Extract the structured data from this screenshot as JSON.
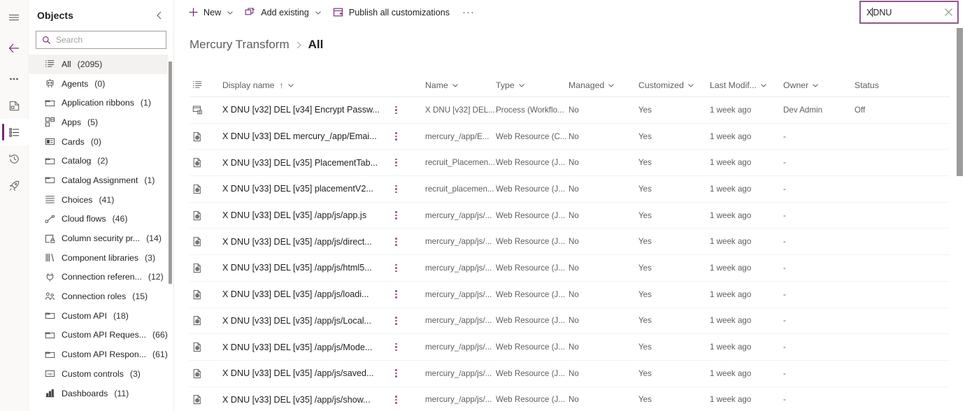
{
  "rail": {
    "items": [
      {
        "name": "hamburger-menu-icon",
        "label": "Menu"
      },
      {
        "name": "back-arrow-icon",
        "label": "Back"
      },
      {
        "name": "more-options-icon",
        "label": "More"
      },
      {
        "name": "solution-icon",
        "label": "Solution"
      },
      {
        "name": "objects-icon",
        "label": "Objects"
      },
      {
        "name": "history-icon",
        "label": "History"
      },
      {
        "name": "rocket-icon",
        "label": "Publish"
      }
    ]
  },
  "sidebar": {
    "title": "Objects",
    "collapse_label": "Collapse",
    "search": {
      "placeholder": "Search",
      "value": ""
    },
    "items": [
      {
        "label": "All",
        "count": "(2095)",
        "icon": "list-icon",
        "selected": true
      },
      {
        "label": "Agents",
        "count": "(0)",
        "icon": "agent-icon",
        "selected": false
      },
      {
        "label": "Application ribbons",
        "count": "(1)",
        "icon": "folder-icon",
        "selected": false
      },
      {
        "label": "Apps",
        "count": "(5)",
        "icon": "apps-icon",
        "selected": false
      },
      {
        "label": "Cards",
        "count": "(0)",
        "icon": "card-icon",
        "selected": false
      },
      {
        "label": "Catalog",
        "count": "(2)",
        "icon": "folder-icon",
        "selected": false
      },
      {
        "label": "Catalog Assignment",
        "count": "(1)",
        "icon": "folder-icon",
        "selected": false
      },
      {
        "label": "Choices",
        "count": "(41)",
        "icon": "choices-icon",
        "selected": false
      },
      {
        "label": "Cloud flows",
        "count": "(46)",
        "icon": "cloudflow-icon",
        "selected": false
      },
      {
        "label": "Column security pr...",
        "count": "(14)",
        "icon": "column-security-icon",
        "selected": false
      },
      {
        "label": "Component libraries",
        "count": "(3)",
        "icon": "library-icon",
        "selected": false
      },
      {
        "label": "Connection referen...",
        "count": "(12)",
        "icon": "connection-icon",
        "selected": false
      },
      {
        "label": "Connection roles",
        "count": "(15)",
        "icon": "roles-icon",
        "selected": false
      },
      {
        "label": "Custom API",
        "count": "(18)",
        "icon": "folder-icon",
        "selected": false
      },
      {
        "label": "Custom API Reques...",
        "count": "(66)",
        "icon": "folder-icon",
        "selected": false
      },
      {
        "label": "Custom API Respon...",
        "count": "(61)",
        "icon": "folder-icon",
        "selected": false
      },
      {
        "label": "Custom controls",
        "count": "(3)",
        "icon": "custom-control-icon",
        "selected": false
      },
      {
        "label": "Dashboards",
        "count": "(11)",
        "icon": "dashboard-icon",
        "selected": false
      }
    ]
  },
  "commandbar": {
    "new_label": "New",
    "add_existing_label": "Add existing",
    "publish_label": "Publish all customizations",
    "overflow_label": "···"
  },
  "topsearch": {
    "value": "X DNU",
    "value_before_caret": "X",
    "value_after_caret": "DNU",
    "clear_label": "Clear"
  },
  "breadcrumb": {
    "parent": "Mercury Transform",
    "separator": "›",
    "current": "All"
  },
  "table": {
    "columns": [
      {
        "key": "icon",
        "label": ""
      },
      {
        "key": "display_name",
        "label": "Display name",
        "sorted": "↑",
        "has_chevron": true
      },
      {
        "key": "kebab",
        "label": ""
      },
      {
        "key": "name",
        "label": "Name",
        "has_chevron": true
      },
      {
        "key": "type",
        "label": "Type",
        "has_chevron": true
      },
      {
        "key": "managed",
        "label": "Managed",
        "has_chevron": true
      },
      {
        "key": "customized",
        "label": "Customized",
        "has_chevron": true
      },
      {
        "key": "last_modified",
        "label": "Last Modif...",
        "has_chevron": true
      },
      {
        "key": "owner",
        "label": "Owner",
        "has_chevron": true
      },
      {
        "key": "status",
        "label": "Status",
        "has_chevron": false
      }
    ],
    "rows": [
      {
        "icon": "process-icon",
        "display_name": "X DNU [v32] DEL [v34] Encrypt Passw...",
        "name": "X DNU [v32] DEL...",
        "type": "Process (Workflo...",
        "managed": "No",
        "customized": "Yes",
        "last_modified": "1 week ago",
        "owner": "Dev Admin",
        "status": "Off"
      },
      {
        "icon": "webresource-icon",
        "display_name": "X DNU [v33] DEL mercury_/app/Emai...",
        "name": "mercury_/app/E...",
        "type": "Web Resource (C...",
        "managed": "No",
        "customized": "Yes",
        "last_modified": "1 week ago",
        "owner": "-",
        "status": ""
      },
      {
        "icon": "webresource-icon",
        "display_name": "X DNU [v33] DEL [v35] PlacementTab...",
        "name": "recruit_Placemen...",
        "type": "Web Resource (J...",
        "managed": "No",
        "customized": "Yes",
        "last_modified": "1 week ago",
        "owner": "-",
        "status": ""
      },
      {
        "icon": "webresource-icon",
        "display_name": "X DNU [v33] DEL [v35] placementV2...",
        "name": "recruit_placemen...",
        "type": "Web Resource (J...",
        "managed": "No",
        "customized": "Yes",
        "last_modified": "1 week ago",
        "owner": "-",
        "status": ""
      },
      {
        "icon": "webresource-icon",
        "display_name": "X DNU [v33] DEL [v35] /app/js/app.js",
        "name": "mercury_/app/js/...",
        "type": "Web Resource (J...",
        "managed": "No",
        "customized": "Yes",
        "last_modified": "1 week ago",
        "owner": "-",
        "status": ""
      },
      {
        "icon": "webresource-icon",
        "display_name": "X DNU [v33] DEL [v35] /app/js/direct...",
        "name": "mercury_/app/js/...",
        "type": "Web Resource (J...",
        "managed": "No",
        "customized": "Yes",
        "last_modified": "1 week ago",
        "owner": "-",
        "status": ""
      },
      {
        "icon": "webresource-icon",
        "display_name": "X DNU [v33] DEL [v35] /app/js/html5...",
        "name": "mercury_/app/js/...",
        "type": "Web Resource (J...",
        "managed": "No",
        "customized": "Yes",
        "last_modified": "1 week ago",
        "owner": "-",
        "status": ""
      },
      {
        "icon": "webresource-icon",
        "display_name": "X DNU [v33] DEL [v35] /app/js/loadi...",
        "name": "mercury_/app/js/...",
        "type": "Web Resource (J...",
        "managed": "No",
        "customized": "Yes",
        "last_modified": "1 week ago",
        "owner": "-",
        "status": ""
      },
      {
        "icon": "webresource-icon",
        "display_name": "X DNU [v33] DEL [v35] /app/js/Local...",
        "name": "mercury_/app/js/...",
        "type": "Web Resource (J...",
        "managed": "No",
        "customized": "Yes",
        "last_modified": "1 week ago",
        "owner": "-",
        "status": ""
      },
      {
        "icon": "webresource-icon",
        "display_name": "X DNU [v33] DEL [v35] /app/js/Mode...",
        "name": "mercury_/app/js/...",
        "type": "Web Resource (J...",
        "managed": "No",
        "customized": "Yes",
        "last_modified": "1 week ago",
        "owner": "-",
        "status": ""
      },
      {
        "icon": "webresource-icon",
        "display_name": "X DNU [v33] DEL [v35] /app/js/saved...",
        "name": "mercury_/app/js/...",
        "type": "Web Resource (J...",
        "managed": "No",
        "customized": "Yes",
        "last_modified": "1 week ago",
        "owner": "-",
        "status": ""
      },
      {
        "icon": "webresource-icon",
        "display_name": "X DNU [v33] DEL [v35] /app/js/show...",
        "name": "mercury_/app/js/...",
        "type": "Web Resource (J...",
        "managed": "No",
        "customized": "Yes",
        "last_modified": "1 week ago",
        "owner": "-",
        "status": ""
      }
    ]
  },
  "colors": {
    "accent": "#742774",
    "selected_row_bg": "#f3f2f1",
    "border": "#edebe9",
    "text_secondary": "#605e5c",
    "kebab": "#a4508a",
    "search_border": "#8c5a8c"
  }
}
